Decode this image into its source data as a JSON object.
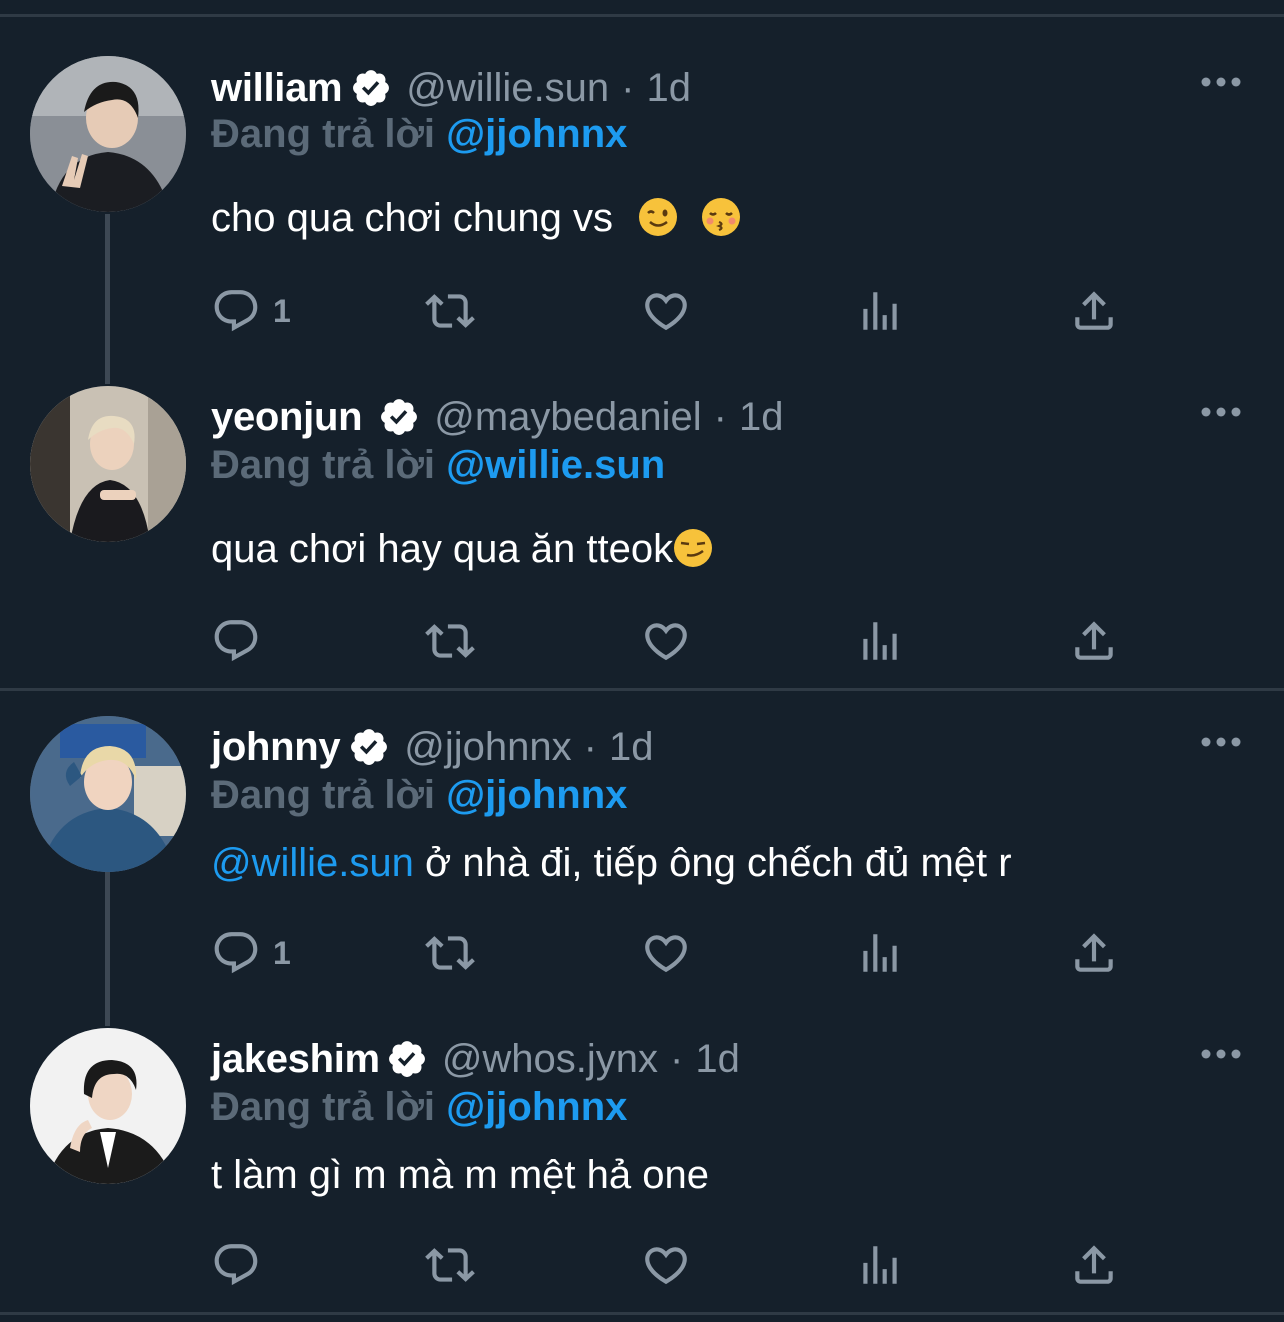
{
  "replying_prefix": "Đang trả lời",
  "tweets": [
    {
      "name": "william",
      "handle": "@willie.sun",
      "time": "1d",
      "reply_to": "@jjohnnx",
      "text": "cho qua chơi chung vs",
      "emojis": [
        "winking-face",
        "kissing-face-closed-eyes"
      ],
      "reply_count": "1"
    },
    {
      "name": "yeonjun",
      "handle": "@maybedaniel",
      "time": "1d",
      "reply_to": "@willie.sun",
      "text": "qua chơi hay qua ăn tteok",
      "emojis": [
        "smirking-face"
      ],
      "reply_count": ""
    },
    {
      "name": "johnny",
      "handle": "@jjohnnx",
      "time": "1d",
      "reply_to": "@jjohnnx",
      "text_mention": "@willie.sun",
      "text": " ở nhà đi, tiếp ông chếch đủ mệt r",
      "reply_count": "1"
    },
    {
      "name": "jakeshim",
      "handle": "@whos.jynx",
      "time": "1d",
      "reply_to": "@jjohnnx",
      "text": "t làm gì m mà m mệt hả one",
      "reply_count": ""
    }
  ],
  "handle_separator": "·",
  "colors": {
    "background": "#15202b",
    "accent": "#1d9bf0",
    "muted": "#8b98a5",
    "divider": "#2f3a45"
  }
}
